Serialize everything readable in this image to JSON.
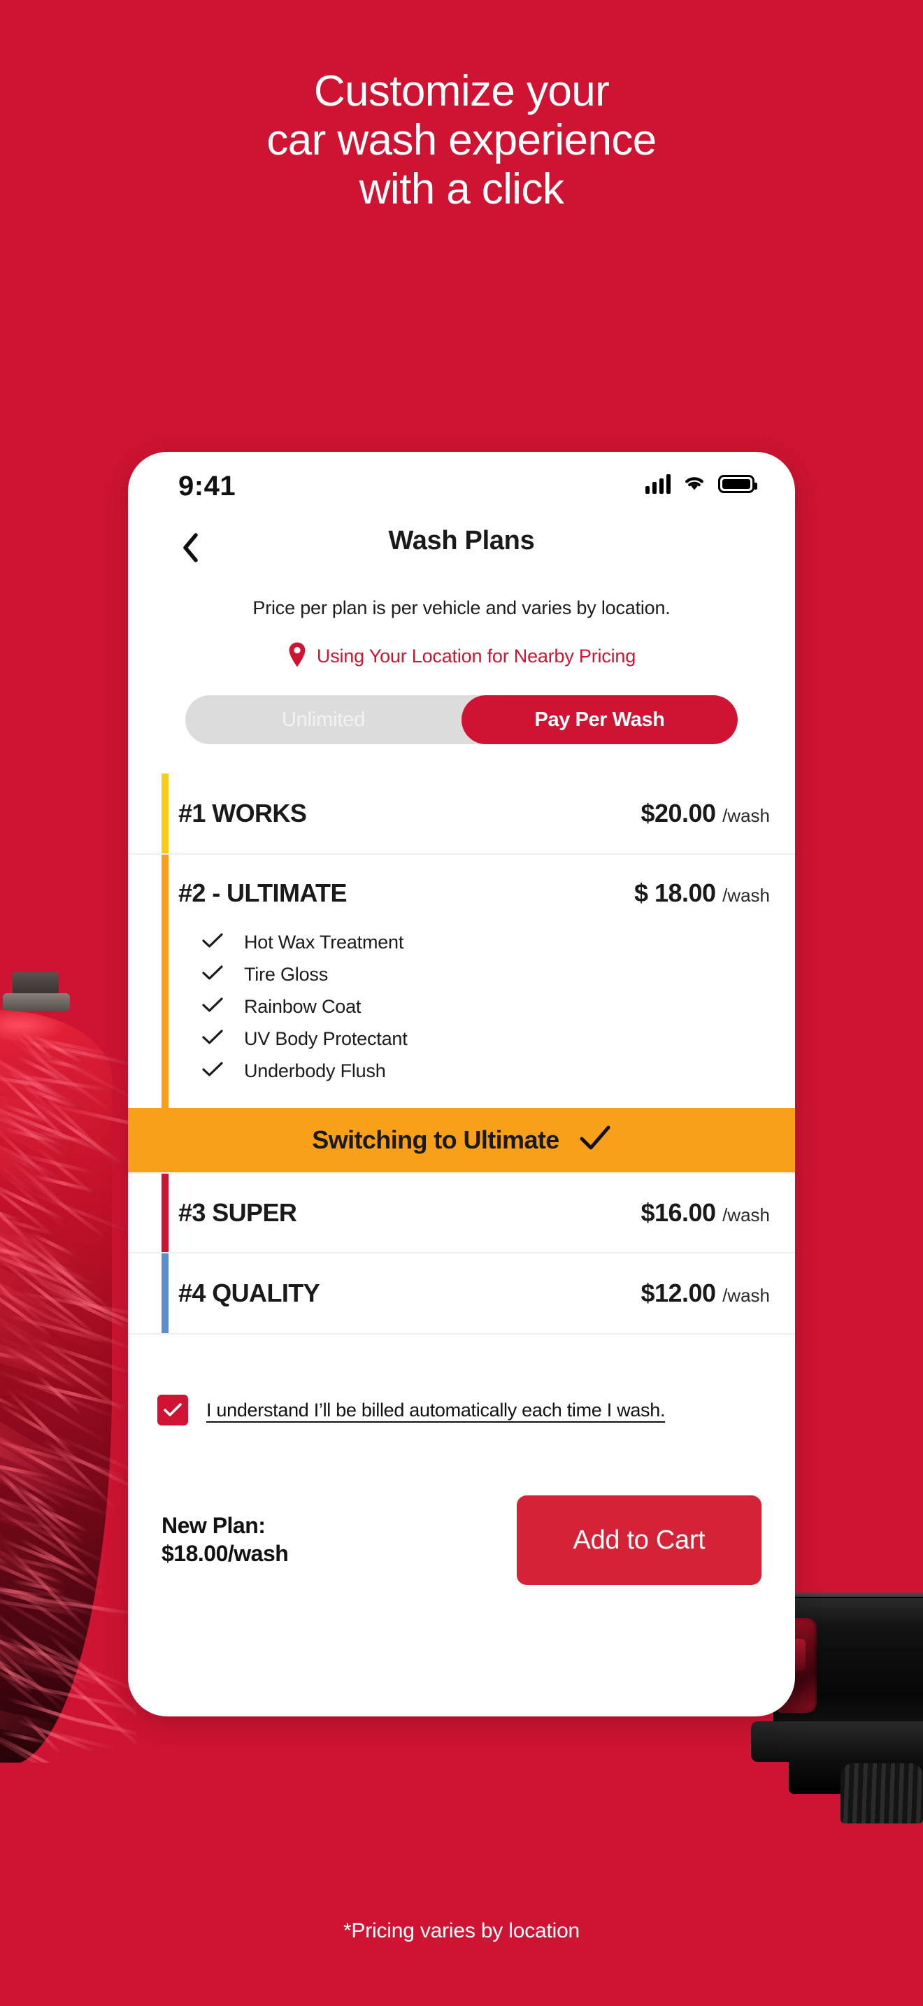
{
  "headline": {
    "line1": "Customize your",
    "line2": "car wash experience",
    "line3": "with a click"
  },
  "footnote": "*Pricing varies by location",
  "colors": {
    "brand_red": "#CE1432",
    "button_red": "#D42236",
    "banner_orange": "#F9A01B",
    "stripe_works": "#F9CB1B",
    "stripe_ultimate": "#F9A01B",
    "stripe_super": "#CE1432",
    "stripe_quality": "#5B8FC9",
    "segment_track": "#DCDCDC"
  },
  "phone": {
    "status": {
      "time": "9:41"
    },
    "nav": {
      "title": "Wash Plans",
      "back_icon": "chevron-left-icon"
    },
    "subtitle": "Price per plan is per vehicle and varies by location.",
    "location_notice": {
      "icon": "map-pin-icon",
      "text": "Using Your Location for Nearby Pricing"
    },
    "segmented": {
      "options": [
        "Unlimited",
        "Pay Per Wash"
      ],
      "selected": "Pay Per Wash"
    },
    "plans": [
      {
        "name": "#1 WORKS",
        "price": "$20.00",
        "per": "/wash",
        "stripe": "#F9CB1B",
        "expanded": false,
        "features": []
      },
      {
        "name": "#2 - ULTIMATE",
        "price": "$ 18.00",
        "per": "/wash",
        "stripe": "#F9A01B",
        "expanded": true,
        "features": [
          "Hot Wax Treatment",
          "Tire Gloss",
          "Rainbow Coat",
          "UV Body Protectant",
          "Underbody Flush"
        ],
        "banner": {
          "label": "Switching to Ultimate",
          "icon": "check-icon"
        }
      },
      {
        "name": "#3 SUPER",
        "price": "$16.00",
        "per": "/wash",
        "stripe": "#CE1432",
        "expanded": false,
        "features": []
      },
      {
        "name": "#4 QUALITY",
        "price": "$12.00",
        "per": "/wash",
        "stripe": "#5B8FC9",
        "expanded": false,
        "features": []
      }
    ],
    "disclaimer": {
      "checked": true,
      "text": "I understand I’ll be billed automatically each time I wash."
    },
    "action": {
      "new_plan_line1": "New Plan:",
      "new_plan_line2": "$18.00/wash",
      "cart_label": "Add to Cart"
    }
  }
}
